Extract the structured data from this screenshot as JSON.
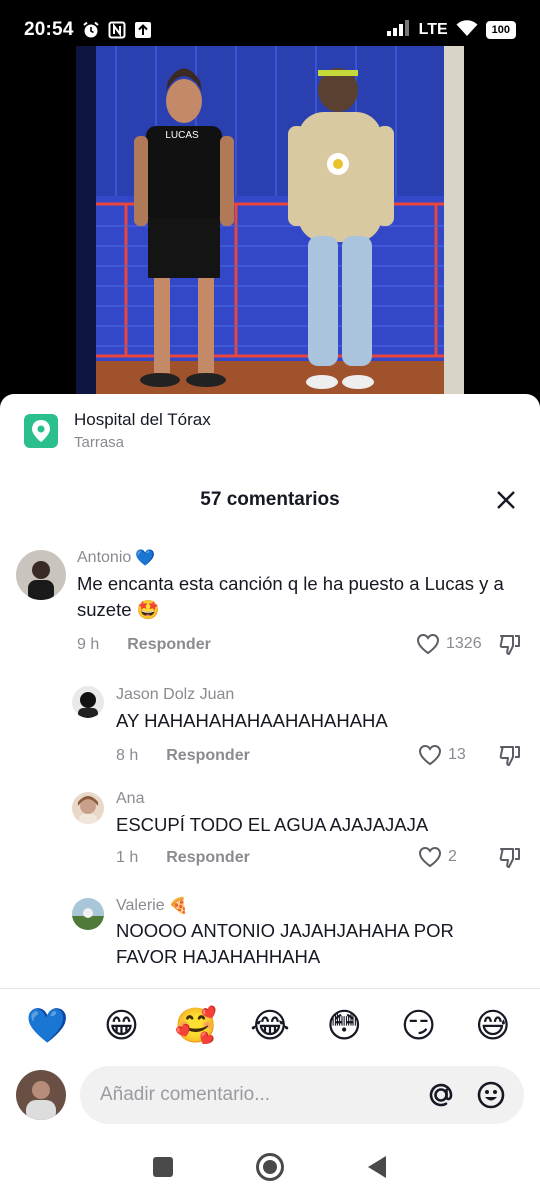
{
  "status_bar": {
    "time": "20:54",
    "network": "LTE",
    "battery": "100"
  },
  "location": {
    "name": "Hospital del Tórax",
    "city": "Tarrasa"
  },
  "comments_header": {
    "title": "57 comentarios"
  },
  "comments": [
    {
      "user": "Antonio",
      "user_badge": "💙",
      "text": "Me encanta esta canción q le ha puesto a Lucas y a suzete 🤩",
      "time": "9 h",
      "reply_label": "Responder",
      "likes": "1326"
    },
    {
      "user": "Jason Dolz Juan",
      "user_badge": "",
      "text": "AY HAHAHAHAHAAHAHAHAHA",
      "time": "8 h",
      "reply_label": "Responder",
      "likes": "13"
    },
    {
      "user": "Ana",
      "user_badge": "",
      "text": "ESCUPÍ TODO EL AGUA AJAJAJAJA",
      "time": "1 h",
      "reply_label": "Responder",
      "likes": "2"
    },
    {
      "user": "Valerie",
      "user_badge": "🍕",
      "text": "NOOOO ANTONIO JAJAHJAHAHA POR FAVOR HAJAHAHHAHA",
      "time": "",
      "reply_label": "",
      "likes": ""
    }
  ],
  "emoji_bar": [
    "💙",
    "😁",
    "🥰",
    "😂",
    "😳",
    "😏",
    "😅"
  ],
  "comment_input": {
    "placeholder": "Añadir comentario..."
  },
  "video": {
    "shirt_text": "LUCAS"
  },
  "colors": {
    "accent_location": "#2bbf8d",
    "text_primary": "#161823",
    "text_secondary": "#8a8b91"
  }
}
